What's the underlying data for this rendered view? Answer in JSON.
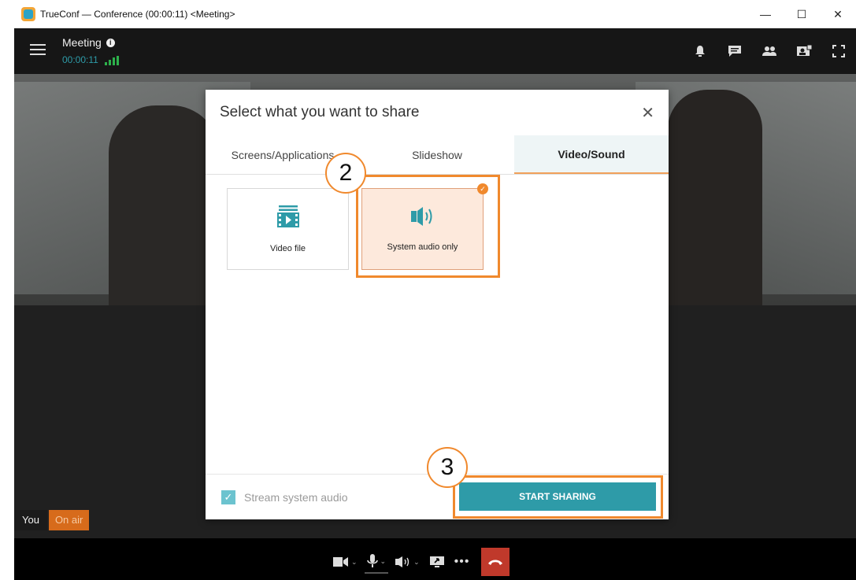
{
  "window": {
    "title": "TrueConf — Conference (00:00:11) <Meeting>",
    "controls": {
      "minimize": "—",
      "maximize": "☐",
      "close": "✕"
    }
  },
  "header": {
    "meeting_title": "Meeting",
    "timer": "00:00:11"
  },
  "topbar_icons": [
    "bell-icon",
    "chat-icon",
    "participants-icon",
    "video-layout-icon",
    "fullscreen-icon"
  ],
  "video": {
    "self_label": "You",
    "on_air": "On air"
  },
  "dialog": {
    "title": "Select what you want to share",
    "close": "✕",
    "tabs": [
      {
        "label": "Screens/Applications",
        "active": false
      },
      {
        "label": "Slideshow",
        "active": false
      },
      {
        "label": "Video/Sound",
        "active": true
      }
    ],
    "tiles": [
      {
        "label": "Video file",
        "icon": "video-file-icon",
        "selected": false
      },
      {
        "label": "System audio only",
        "icon": "speaker-icon",
        "selected": true
      }
    ],
    "stream_audio_label": "Stream system audio",
    "stream_audio_checked": true,
    "start_button": "START SHARING"
  },
  "annotations": {
    "step2": "2",
    "step3": "3"
  },
  "colors": {
    "accent": "#2e9ba8",
    "highlight": "#f0892d",
    "end_call": "#c0392b",
    "on_air": "#d76b1b"
  }
}
